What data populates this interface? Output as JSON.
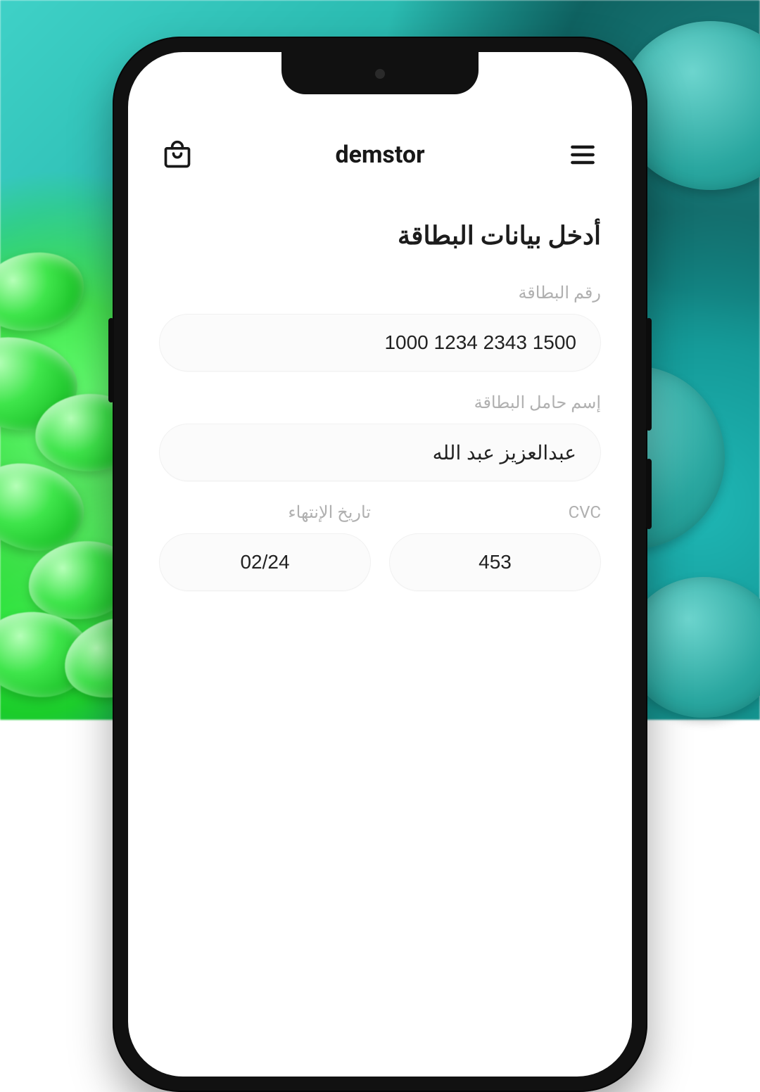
{
  "header": {
    "brand": "demstor"
  },
  "form": {
    "title": "أدخل بيانات البطاقة",
    "card_number_label": "رقم البطاقة",
    "card_number_value": "1500 2343 1234 1000",
    "card_holder_label": "إسم حامل البطاقة",
    "card_holder_value": "عبدالعزيز عبد الله",
    "expiry_label": "تاريخ الإنتهاء",
    "expiry_value": "02/24",
    "cvc_label": "CVC",
    "cvc_value": "453"
  }
}
